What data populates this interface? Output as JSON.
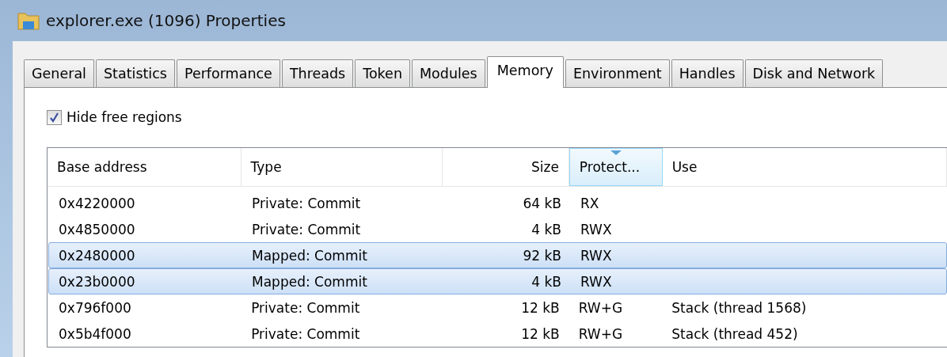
{
  "window": {
    "title": "explorer.exe (1096) Properties"
  },
  "tabs": [
    {
      "label": "General",
      "selected": false
    },
    {
      "label": "Statistics",
      "selected": false
    },
    {
      "label": "Performance",
      "selected": false
    },
    {
      "label": "Threads",
      "selected": false
    },
    {
      "label": "Token",
      "selected": false
    },
    {
      "label": "Modules",
      "selected": false
    },
    {
      "label": "Memory",
      "selected": true
    },
    {
      "label": "Environment",
      "selected": false
    },
    {
      "label": "Handles",
      "selected": false
    },
    {
      "label": "Disk and Network",
      "selected": false
    }
  ],
  "hide_free_regions": {
    "label": "Hide free regions",
    "checked": true
  },
  "table": {
    "columns": [
      {
        "label": "Base address",
        "right_aligned": false,
        "sorted": false
      },
      {
        "label": "Type",
        "right_aligned": false,
        "sorted": false
      },
      {
        "label": "Size",
        "right_aligned": true,
        "sorted": false
      },
      {
        "label": "Protect...",
        "right_aligned": false,
        "sorted": true
      },
      {
        "label": "Use",
        "right_aligned": false,
        "sorted": false
      }
    ],
    "rows": [
      {
        "cells": [
          "0x4220000",
          "Private: Commit",
          "64 kB",
          "RX"
        ],
        "selected": false
      },
      {
        "cells": [
          "0x4850000",
          "Private: Commit",
          "4 kB",
          "RWX"
        ],
        "selected": false
      },
      {
        "cells": [
          "0x2480000",
          "Mapped: Commit",
          "92 kB",
          "RWX"
        ],
        "selected": true
      },
      {
        "cells": [
          "0x23b0000",
          "Mapped: Commit",
          "4 kB",
          "RWX"
        ],
        "selected": true
      },
      {
        "cells": [
          "0x796f000",
          "Private: Commit",
          "12 kB",
          "RW+G",
          "Stack (thread 1568)"
        ],
        "selected": false
      },
      {
        "cells": [
          "0x5b4f000",
          "Private: Commit",
          "12 kB",
          "RW+G",
          "Stack (thread 452)"
        ],
        "selected": false
      }
    ]
  }
}
